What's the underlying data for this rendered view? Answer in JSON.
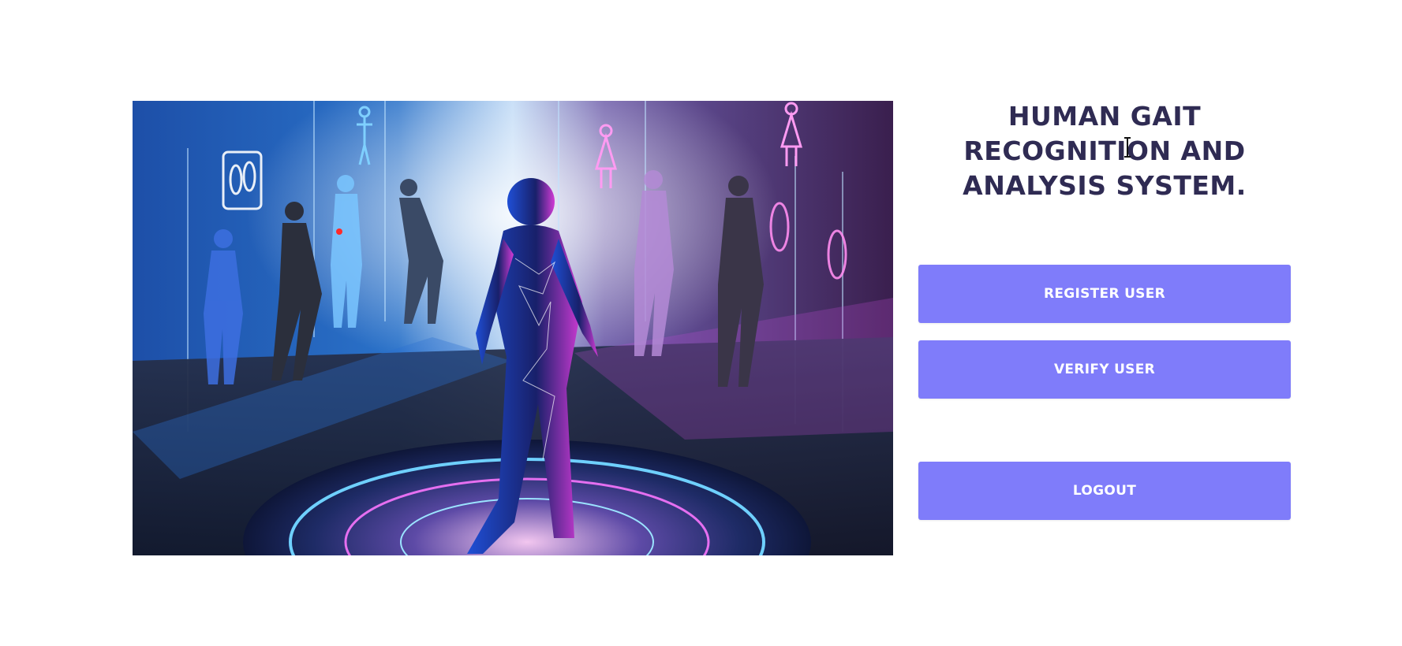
{
  "header": {
    "title": "HUMAN GAIT RECOGNITION AND ANALYSIS SYSTEM."
  },
  "hero": {
    "image_icon": "walking-figures-illustration"
  },
  "actions": {
    "register_label": "REGISTER USER",
    "verify_label": "VERIFY USER",
    "logout_label": "LOGOUT"
  },
  "colors": {
    "button": "#7f7cfa",
    "button_text": "#ffffff",
    "title": "#2f2b53"
  }
}
